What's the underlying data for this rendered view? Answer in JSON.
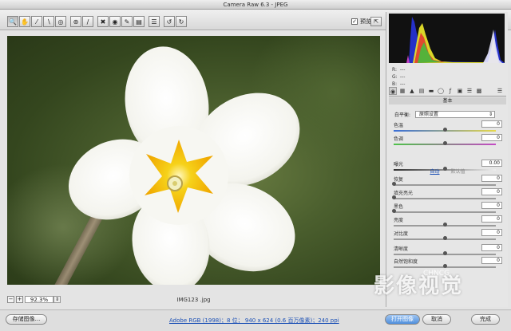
{
  "window": {
    "title": "Camera Raw 6.3 -  JPEG"
  },
  "toolbar": {
    "tools": [
      "zoom-tool",
      "hand-tool",
      "white-balance-tool",
      "color-sampler-tool",
      "target-adjust-tool",
      "crop-tool",
      "straighten-tool",
      "spot-removal-tool",
      "red-eye-tool",
      "adjustment-brush-tool",
      "graduated-filter-tool",
      "preferences",
      "rotate-ccw",
      "rotate-cw"
    ],
    "preview_label": "预览",
    "preview_checked": true
  },
  "image": {
    "filename": "IMG123 .jpg"
  },
  "zoom": {
    "value": "92.3%"
  },
  "bottom": {
    "save_label": "存储图像...",
    "workflow_text": "Adobe RGB (1998)；8 位；  940 x 624 (0.6 百万像素)；240 ppi",
    "open_label": "打开图像",
    "cancel_label": "取消",
    "done_label": "完成"
  },
  "panel": {
    "rgb": {
      "r_label": "R:",
      "g_label": "G:",
      "b_label": "B:",
      "r": "---",
      "g": "---",
      "b": "---"
    },
    "section_title": "基本",
    "white_balance_label": "白平衡:",
    "white_balance_value": "原照设置",
    "auto_label": "自动",
    "default_label": "默认值",
    "sliders": [
      {
        "label": "色温",
        "value": "0",
        "pos": 0.5,
        "track": "temp"
      },
      {
        "label": "色调",
        "value": "0",
        "pos": 0.5,
        "track": "tint"
      },
      {
        "label": "曝光",
        "value": "0.00",
        "pos": 0.5,
        "track": "dark"
      },
      {
        "label": "恢复",
        "value": "0",
        "pos": 0.0,
        "track": "plain"
      },
      {
        "label": "填充亮光",
        "value": "0",
        "pos": 0.0,
        "track": "plain"
      },
      {
        "label": "黑色",
        "value": "0",
        "pos": 0.0,
        "track": "plain"
      },
      {
        "label": "亮度",
        "value": "0",
        "pos": 0.5,
        "track": "plain"
      },
      {
        "label": "对比度",
        "value": "0",
        "pos": 0.5,
        "track": "plain"
      },
      {
        "label": "清晰度",
        "value": "0",
        "pos": 0.5,
        "track": "plain"
      },
      {
        "label": "自然饱和度",
        "value": "0",
        "pos": 0.5,
        "track": "plain"
      }
    ]
  },
  "watermark": {
    "text": "影像视觉",
    "latin": "CHNCG"
  }
}
